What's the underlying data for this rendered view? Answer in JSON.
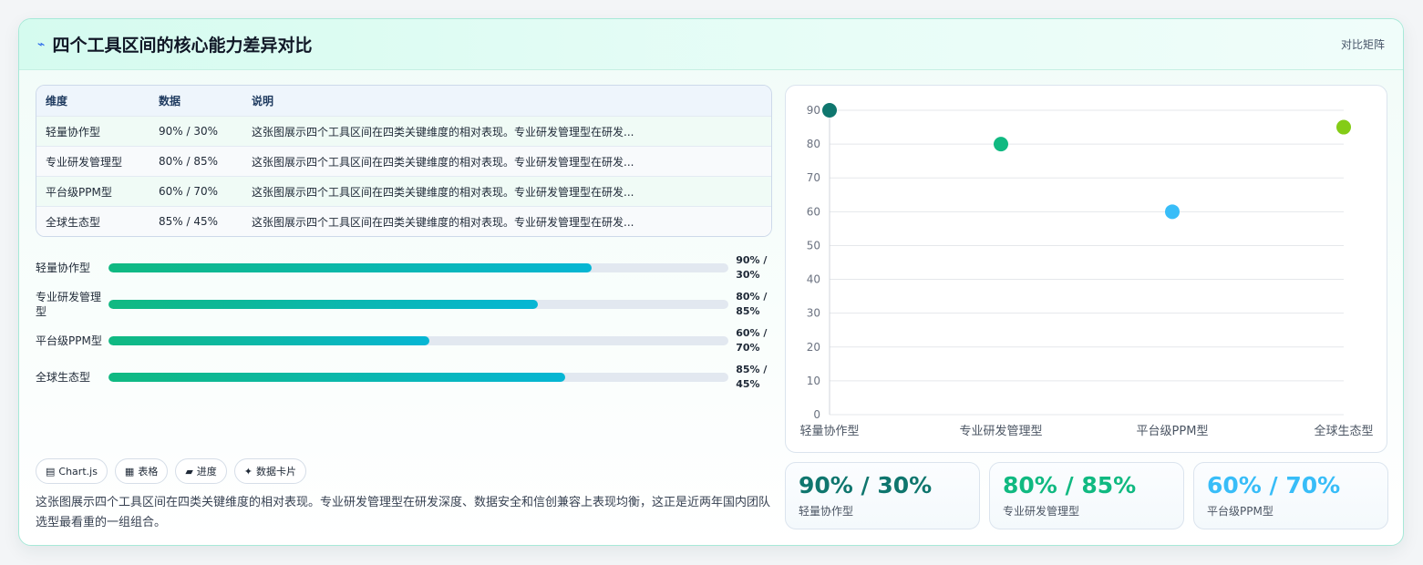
{
  "header": {
    "title_icon": "⌁",
    "title": "四个工具区间的核心能力差异对比",
    "badge": "对比矩阵"
  },
  "table": {
    "columns": [
      "维度",
      "数据",
      "说明"
    ],
    "rows": [
      {
        "dim": "轻量协作型",
        "data": "90% / 30%",
        "desc": "这张图展示四个工具区间在四类关键维度的相对表现。专业研发管理型在研发..."
      },
      {
        "dim": "专业研发管理型",
        "data": "80% / 85%",
        "desc": "这张图展示四个工具区间在四类关键维度的相对表现。专业研发管理型在研发..."
      },
      {
        "dim": "平台级PPM型",
        "data": "60% / 70%",
        "desc": "这张图展示四个工具区间在四类关键维度的相对表现。专业研发管理型在研发..."
      },
      {
        "dim": "全球生态型",
        "data": "85% / 45%",
        "desc": "这张图展示四个工具区间在四类关键维度的相对表现。专业研发管理型在研发..."
      }
    ]
  },
  "progress": [
    {
      "label": "轻量协作型",
      "value_text": "90% / 30%",
      "fill": 0.78
    },
    {
      "label": "专业研发管理型",
      "value_text": "80% / 85%",
      "fill": 0.693
    },
    {
      "label": "平台级PPM型",
      "value_text": "60% / 70%",
      "fill": 0.518
    },
    {
      "label": "全球生态型",
      "value_text": "85% / 45%",
      "fill": 0.736
    }
  ],
  "chips": [
    {
      "icon": "chart-icon",
      "glyph": "▤",
      "label": "Chart.js"
    },
    {
      "icon": "table-icon",
      "glyph": "▦",
      "label": "表格"
    },
    {
      "icon": "progress-icon",
      "glyph": "▰",
      "label": "进度"
    },
    {
      "icon": "sparkle-icon",
      "glyph": "✦",
      "label": "数据卡片"
    }
  ],
  "description": "这张图展示四个工具区间在四类关键维度的相对表现。专业研发管理型在研发深度、数据安全和信创兼容上表现均衡，这正是近两年国内团队选型最看重的一组组合。",
  "chart_data": {
    "type": "scatter",
    "categories": [
      "轻量协作型",
      "专业研发管理型",
      "平台级PPM型",
      "全球生态型"
    ],
    "values": [
      90,
      80,
      60,
      85
    ],
    "colors": [
      "#0f766e",
      "#10b981",
      "#38bdf8",
      "#84cc16"
    ],
    "ylim": [
      0,
      90
    ],
    "yticks": [
      0,
      10,
      20,
      30,
      40,
      50,
      60,
      70,
      80,
      90
    ],
    "grid": true,
    "title": "",
    "xlabel": "",
    "ylabel": ""
  },
  "kpis": [
    {
      "value": "90% / 30%",
      "label": "轻量协作型",
      "color": "#0f766e"
    },
    {
      "value": "80% / 85%",
      "label": "专业研发管理型",
      "color": "#10b981"
    },
    {
      "value": "60% / 70%",
      "label": "平台级PPM型",
      "color": "#38bdf8"
    }
  ]
}
